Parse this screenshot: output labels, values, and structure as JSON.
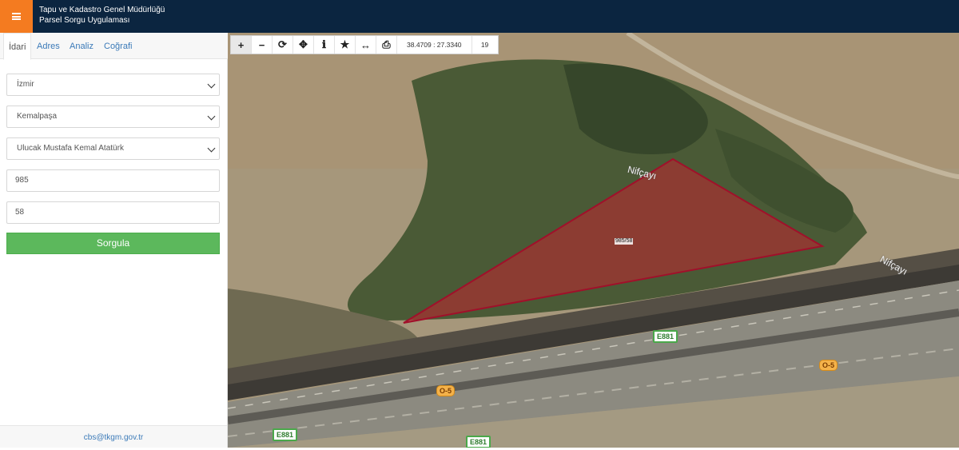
{
  "header": {
    "title_line1": "Tapu ve Kadastro Genel Müdürlüğü",
    "title_line2": "Parsel Sorgu Uygulaması",
    "menu_icon": "hamburger-icon",
    "accent_color": "#f47b20",
    "bar_color": "#0b2540"
  },
  "sidebar": {
    "tabs": [
      {
        "label": "İdari",
        "active": true
      },
      {
        "label": "Adres",
        "active": false
      },
      {
        "label": "Analiz",
        "active": false
      },
      {
        "label": "Coğrafi",
        "active": false
      }
    ],
    "province": "İzmir",
    "district": "Kemalpaşa",
    "neighborhood": "Ulucak Mustafa Kemal Atatürk",
    "block_no": "985",
    "parcel_no": "58",
    "query_label": "Sorgula",
    "query_color": "#5cb85c",
    "footer_email": "cbs@tkgm.gov.tr"
  },
  "map": {
    "toolbar": {
      "icons": [
        "zoom-in-icon",
        "zoom-out-icon",
        "refresh-icon",
        "locate-icon",
        "info-icon",
        "star-icon",
        "measure-icon",
        "print-icon"
      ],
      "coordinates": "38.4709 : 27.3340",
      "zoom_level": "19"
    },
    "parcel_label": "985/58",
    "river_label_1": "Nifçayı",
    "river_label_2": "Nifçayı",
    "road_badges": {
      "e881_a": "E881",
      "e881_b": "E881",
      "e881_c": "E881",
      "o5_a": "O-5",
      "o5_b": "O-5"
    }
  }
}
